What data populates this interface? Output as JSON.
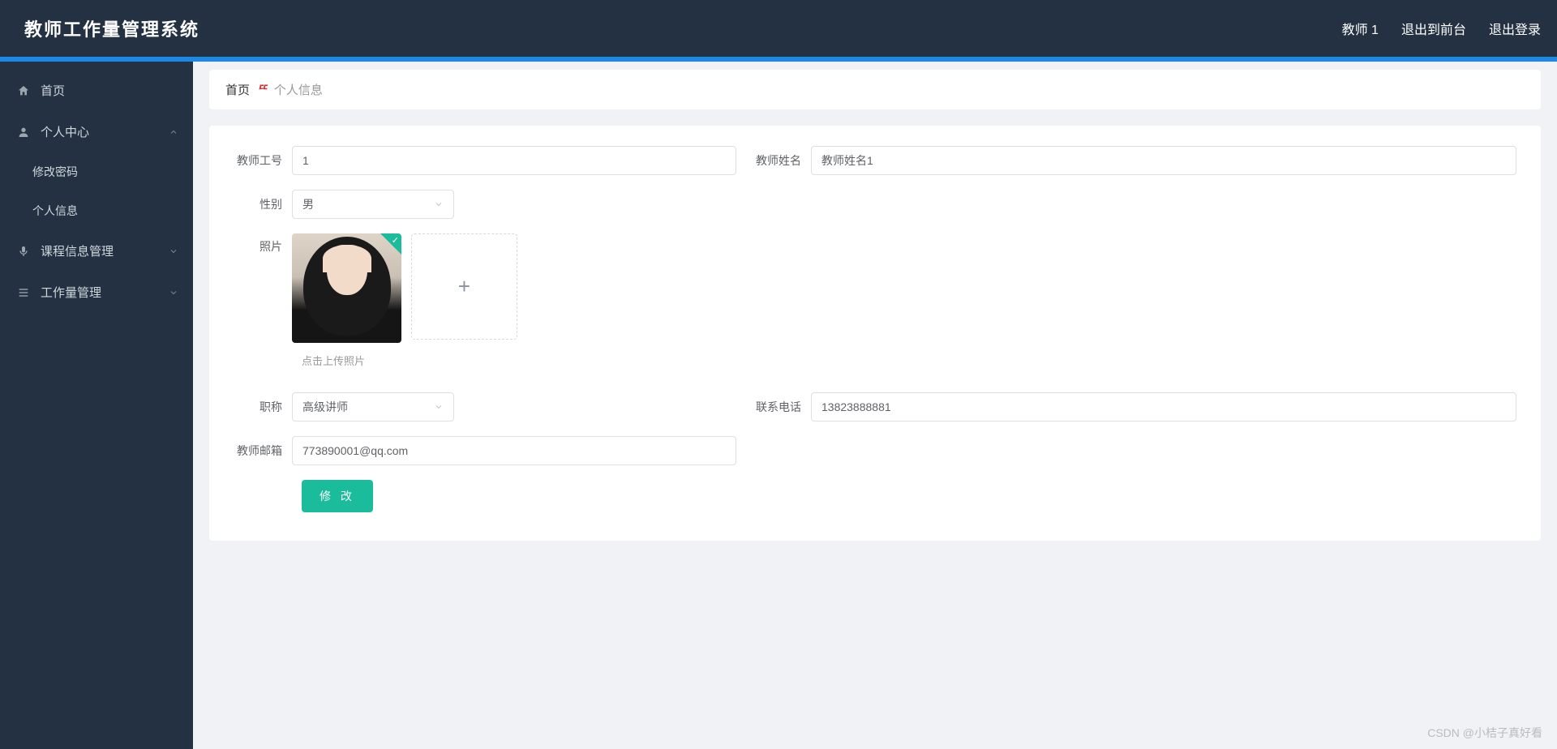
{
  "header": {
    "title": "教师工作量管理系统",
    "user_label": "教师 1",
    "exit_front_label": "退出到前台",
    "logout_label": "退出登录"
  },
  "sidebar": {
    "items": [
      {
        "icon": "home",
        "label": "首页",
        "expandable": false
      },
      {
        "icon": "user",
        "label": "个人中心",
        "expandable": true,
        "expanded": true,
        "children": [
          {
            "label": "修改密码"
          },
          {
            "label": "个人信息"
          }
        ]
      },
      {
        "icon": "mic",
        "label": "课程信息管理",
        "expandable": true,
        "expanded": false
      },
      {
        "icon": "list",
        "label": "工作量管理",
        "expandable": true,
        "expanded": false
      }
    ]
  },
  "breadcrumb": {
    "home": "首页",
    "sep": "ᄄ",
    "current": "个人信息"
  },
  "form": {
    "teacher_id_label": "教师工号",
    "teacher_id_value": "1",
    "teacher_name_label": "教师姓名",
    "teacher_name_value": "教师姓名1",
    "gender_label": "性别",
    "gender_value": "男",
    "photo_label": "照片",
    "photo_hint": "点击上传照片",
    "title_label": "职称",
    "title_value": "高级讲师",
    "phone_label": "联系电话",
    "phone_value": "13823888881",
    "email_label": "教师邮箱",
    "email_value": "773890001@qq.com",
    "submit_label": "修 改"
  },
  "watermark": "CSDN @小桔子真好看"
}
